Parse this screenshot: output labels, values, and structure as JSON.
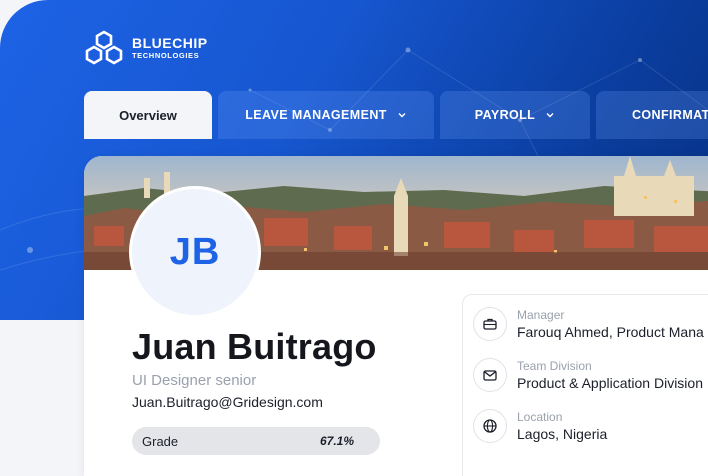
{
  "brand": {
    "name": "BLUECHIP",
    "subtitle": "TECHNOLOGIES"
  },
  "tabs": [
    {
      "label": "Overview",
      "active": true,
      "dropdown": false
    },
    {
      "label": "LEAVE MANAGEMENT",
      "active": false,
      "dropdown": true
    },
    {
      "label": "PAYROLL",
      "active": false,
      "dropdown": true
    },
    {
      "label": "CONFIRMAT",
      "active": false,
      "dropdown": false
    }
  ],
  "profile": {
    "initials": "JB",
    "name": "Juan Buitrago",
    "role": "UI Designer senior",
    "email": "Juan.Buitrago@Gridesign.com",
    "grade_label": "Grade",
    "grade_value": "67.1%"
  },
  "details": [
    {
      "label": "Manager",
      "value": "Farouq Ahmed, Product Mana",
      "icon": "briefcase-icon"
    },
    {
      "label": "Team Division",
      "value": "Product & Application Division",
      "icon": "mail-icon"
    },
    {
      "label": "Location",
      "value": "Lagos, Nigeria",
      "icon": "globe-icon"
    }
  ],
  "colors": {
    "primary": "#1e63e6",
    "hero_dark": "#0a3d9e",
    "text": "#15171d",
    "muted": "#9aa1ad"
  }
}
